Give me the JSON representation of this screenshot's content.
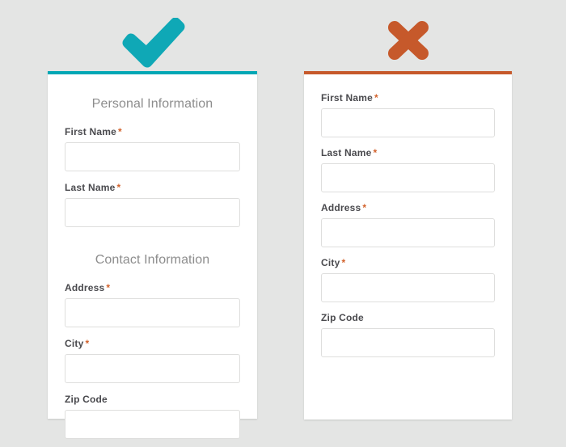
{
  "page": {
    "background_color": "#e4e5e4"
  },
  "colors": {
    "good_accent": "#00a7b5",
    "bad_accent": "#c6592b",
    "required_marker": "#d2622c",
    "label_text": "#4a4a4e",
    "heading_text": "#8d8d8d",
    "input_border": "#dededd",
    "card_background": "#ffffff"
  },
  "good_example": {
    "icon": "check-mark-icon",
    "accent_color": "#00a7b5",
    "sections": [
      {
        "heading": "Personal Information",
        "fields": [
          {
            "label": "First Name",
            "required": true,
            "value": "",
            "placeholder": ""
          },
          {
            "label": "Last Name",
            "required": true,
            "value": "",
            "placeholder": ""
          }
        ]
      },
      {
        "heading": "Contact Information",
        "fields": [
          {
            "label": "Address",
            "required": true,
            "value": "",
            "placeholder": ""
          },
          {
            "label": "City",
            "required": true,
            "value": "",
            "placeholder": ""
          },
          {
            "label": "Zip Code",
            "required": false,
            "value": "",
            "placeholder": ""
          }
        ]
      }
    ]
  },
  "bad_example": {
    "icon": "cross-mark-icon",
    "accent_color": "#c6592b",
    "sections": [
      {
        "heading": "",
        "fields": [
          {
            "label": "First Name",
            "required": true,
            "value": "",
            "placeholder": ""
          },
          {
            "label": "Last Name",
            "required": true,
            "value": "",
            "placeholder": ""
          },
          {
            "label": "Address",
            "required": true,
            "value": "",
            "placeholder": ""
          },
          {
            "label": "City",
            "required": true,
            "value": "",
            "placeholder": ""
          },
          {
            "label": "Zip Code",
            "required": false,
            "value": "",
            "placeholder": ""
          }
        ]
      }
    ]
  },
  "required_marker_glyph": "*"
}
